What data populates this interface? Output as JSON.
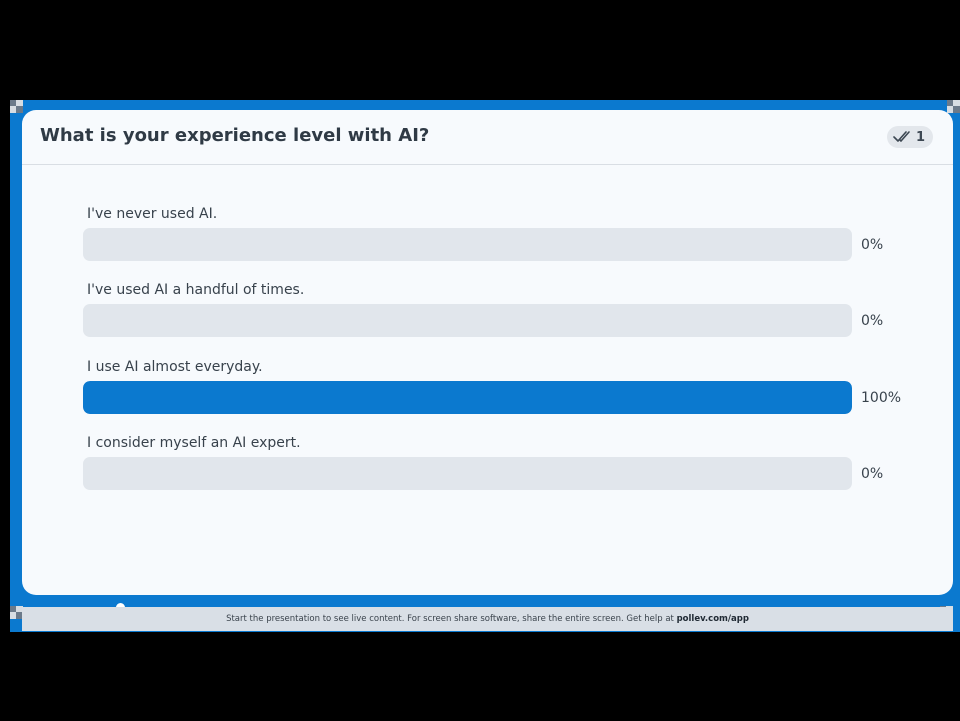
{
  "poll": {
    "title": "What is your experience level with AI?",
    "response_count": "1",
    "options": [
      {
        "label": "I've never used AI.",
        "percent_label": "0%",
        "percent": 0
      },
      {
        "label": "I've used AI a handful of times.",
        "percent_label": "0%",
        "percent": 0
      },
      {
        "label": "I use AI almost everyday.",
        "percent_label": "100%",
        "percent": 100
      },
      {
        "label": "I consider myself an AI expert.",
        "percent_label": "0%",
        "percent": 0
      }
    ]
  },
  "footer": {
    "text": "Start the presentation to see live content. For screen share software, share the entire screen. Get help at ",
    "link": "pollev.com/app"
  },
  "colors": {
    "accent": "#0b79cf",
    "track": "#e1e6ec",
    "card": "#f7fafd"
  },
  "icons": {
    "responses": "double-check-icon"
  }
}
